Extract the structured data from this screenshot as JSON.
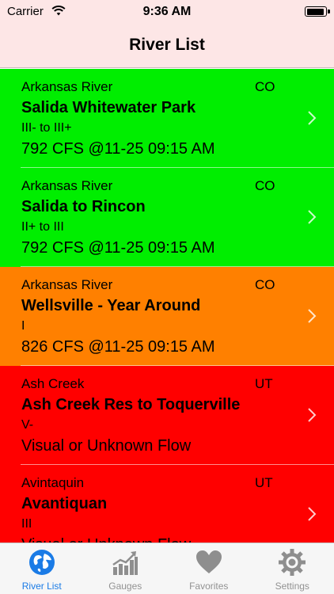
{
  "status_bar": {
    "carrier": "Carrier",
    "time": "9:36 AM",
    "battery_level": 0.95
  },
  "nav": {
    "title": "River List"
  },
  "rivers": [
    {
      "river": "Arkansas River",
      "state": "CO",
      "section": "Salida Whitewater Park",
      "class": "III- to III+",
      "flow": "792 CFS @11-25 09:15 AM",
      "color": "#00ee00"
    },
    {
      "river": "Arkansas River",
      "state": "CO",
      "section": "Salida to Rincon",
      "class": "II+ to III",
      "flow": "792 CFS @11-25 09:15 AM",
      "color": "#00ee00"
    },
    {
      "river": "Arkansas River",
      "state": "CO",
      "section": "Wellsville - Year Around",
      "class": "I",
      "flow": "826 CFS @11-25 09:15 AM",
      "color": "#ff8000"
    },
    {
      "river": "Ash Creek",
      "state": "UT",
      "section": "Ash Creek Res to Toquerville",
      "class": "V-",
      "flow": "Visual or Unknown Flow",
      "color": "#ff0000"
    },
    {
      "river": "Avintaquin",
      "state": "UT",
      "section": "Avantiquan",
      "class": "III",
      "flow": "Visual or Unknown Flow",
      "color": "#ff0000"
    }
  ],
  "tabs": [
    {
      "label": "River List",
      "icon": "globe-icon",
      "active": true
    },
    {
      "label": "Gauges",
      "icon": "chart-icon",
      "active": false
    },
    {
      "label": "Favorites",
      "icon": "heart-icon",
      "active": false
    },
    {
      "label": "Settings",
      "icon": "gear-icon",
      "active": false
    }
  ],
  "colors": {
    "accent": "#1a7be6",
    "inactive_tab": "#929292",
    "bar_background": "#fde6e6"
  }
}
